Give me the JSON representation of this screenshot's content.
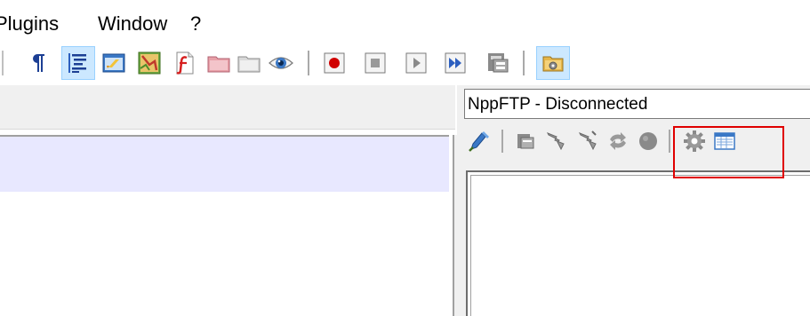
{
  "menu": {
    "items": [
      {
        "label": "Plugins"
      },
      {
        "label": "Window"
      },
      {
        "label": "?"
      }
    ]
  },
  "toolbar": {
    "buttons": [
      "show-all-characters-icon",
      "indent-guide-icon",
      "define-language-icon",
      "document-map-icon",
      "function-list-icon",
      "folder-as-workspace-icon",
      "monitoring-icon",
      "start-recording-icon",
      "stop-recording-icon",
      "playback-icon",
      "run-macro-multiple-icon",
      "save-macro-icon",
      "nppftp-icon"
    ]
  },
  "ftp": {
    "title": "NppFTP - Disconnected",
    "buttons": [
      "connect-icon",
      "open-directory-icon",
      "download-icon",
      "upload-icon",
      "refresh-icon",
      "abort-icon",
      "settings-icon",
      "message-window-icon"
    ]
  },
  "colors": {
    "current_line": "#e8e8ff",
    "highlight": "#e00000",
    "panel_bg": "#f0f0f0"
  }
}
